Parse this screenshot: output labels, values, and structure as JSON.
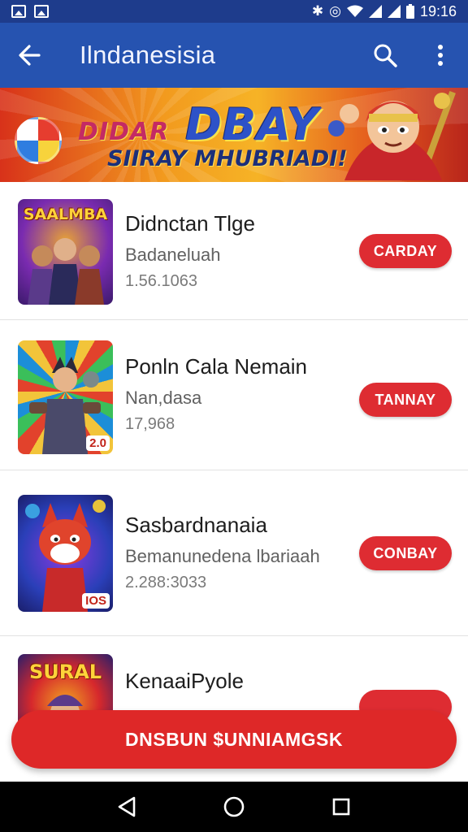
{
  "status_bar": {
    "time": "19:16"
  },
  "app_bar": {
    "title": "Ilndanesisia"
  },
  "banner": {
    "prefix": "DIDAR",
    "title": "DBAY",
    "subtitle": "SIIRAY MHUBRIADI!"
  },
  "items": [
    {
      "thumb_label": "SAALMBA",
      "thumb_badge": "",
      "title": "Didnctan Tlge",
      "subtitle": "Badaneluah",
      "meta": "1.56.1063",
      "action": "CARDAY",
      "colors": [
        "#3b1a6b",
        "#7a2bb0",
        "#e8a335"
      ]
    },
    {
      "thumb_label": "",
      "thumb_badge": "2.0",
      "title": "Ponln Cala Nemain",
      "subtitle": "Nan,dasa",
      "meta": "17,968",
      "action": "TANNAY",
      "colors": [
        "#1c8ed8",
        "#f2c43a",
        "#e2422c"
      ]
    },
    {
      "thumb_label": "",
      "thumb_badge": "IOS",
      "title": "Sasbardnanaia",
      "subtitle": "Bemanunedena lbariaah",
      "meta": "2.288:3033",
      "action": "CONBAY",
      "colors": [
        "#2a3fb8",
        "#8a3ae0",
        "#e03a2a"
      ]
    },
    {
      "thumb_label": "SURAL",
      "thumb_badge": "",
      "title": "KenaaiPyole",
      "subtitle": "",
      "meta": "",
      "action": "",
      "colors": [
        "#f0a222",
        "#2a1e6a",
        "#d6282c"
      ]
    }
  ],
  "cta": {
    "label": "DNSBUN $UNNIAMGSK"
  }
}
